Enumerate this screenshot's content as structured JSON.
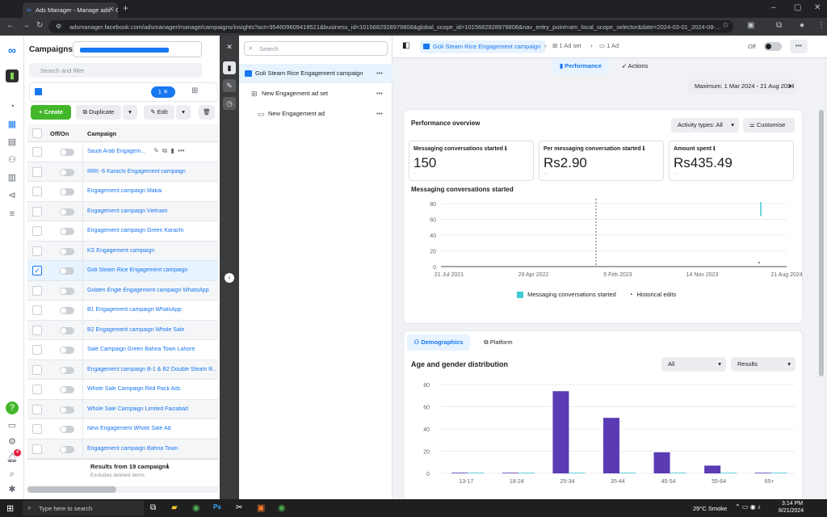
{
  "browser": {
    "tab_title": "Ads Manager - Manage ads - C",
    "url": "adsmanager.facebook.com/adsmanager/manage/campaigns/insights?act=954609609418521&business_id=1015682928979808&global_scope_id=1015682928979808&nav_entry_point=am_local_scope_selector&date=2024-03-01_2024-08-..."
  },
  "campaigns_panel": {
    "title": "Campaigns",
    "search_placeholder": "Search and filter",
    "filter_count": "1",
    "create_label": "Create",
    "duplicate_label": "Duplicate",
    "edit_label": "Edit",
    "col_offon": "Off/On",
    "col_campaign": "Campaign",
    "rows": [
      {
        "name": "Saudi Arab Engagem...",
        "checked": false
      },
      {
        "name": "IRRI -6 Karachi Engagement campaign",
        "checked": false
      },
      {
        "name": "Engagement campaign Makai",
        "checked": false
      },
      {
        "name": "Engagement campaign Vietnam",
        "checked": false
      },
      {
        "name": "Engagement campaign Green Karachi",
        "checked": false
      },
      {
        "name": "KS Engagement campaign",
        "checked": false
      },
      {
        "name": "Goli Steam Rice Engagement campaign",
        "checked": true
      },
      {
        "name": "Golden Engle Engagement campaign WhatsApp",
        "checked": false
      },
      {
        "name": "B1 Engagement campaign WhatsApp",
        "checked": false
      },
      {
        "name": "B2 Engagement campaign Whole Sale",
        "checked": false
      },
      {
        "name": "Sale Campaign Green Bahira Town Lahore",
        "checked": false
      },
      {
        "name": "Engagement campaign B-1 & B2 Double Steam R...",
        "checked": false
      },
      {
        "name": "Whole Sale Campaign Red Pack Ads",
        "checked": false
      },
      {
        "name": "Whole Sale Campaign Limited Faizabad",
        "checked": false
      },
      {
        "name": "New Engagement Whole Sale Ad",
        "checked": false
      },
      {
        "name": "Engagement campaign Bahria Town",
        "checked": false
      }
    ],
    "results_label": "Results from 19 campaigns",
    "results_sub": "Excludes deleted items"
  },
  "tree": {
    "search_placeholder": "Search",
    "campaign": "Goli Steam Rice Engagement campaign",
    "adset": "New Engagement ad set",
    "ad": "New Engagement ad"
  },
  "header": {
    "breadcrumb_campaign": "Goli Steam Rice Engagement campaign",
    "breadcrumb_adset": "1 Ad set",
    "breadcrumb_ad": "1 Ad",
    "toggle_label": "Off",
    "tab_performance": "Performance",
    "tab_actions": "Actions",
    "date_range": "Maximum: 1 Mar 2024 - 21 Aug 2024"
  },
  "overview": {
    "title": "Performance overview",
    "activity_types": "Activity types: All",
    "customise": "Customise",
    "metrics": [
      {
        "label": "Messaging conversations started",
        "value": "150",
        "delta": "--"
      },
      {
        "label": "Per messaging conversation started",
        "value": "Rs2.90",
        "delta": "--"
      },
      {
        "label": "Amount spent",
        "value": "Rs435.49",
        "delta": "--"
      }
    ],
    "chart_title": "Messaging conversations started",
    "legend_series": "Messaging conversations started",
    "legend_hist": "Historical edits"
  },
  "demographics": {
    "tab_demographics": "Demographics",
    "tab_platform": "Platform",
    "title": "Age and gender distribution",
    "filter_all": "All",
    "filter_results": "Results"
  },
  "taskbar": {
    "search": "Type here to search",
    "weather": "29°C  Smoke",
    "time": "3:14 PM",
    "date": "8/21/2024"
  },
  "colors": {
    "brand": "#1877f2",
    "bar": "#5b3bb4",
    "line": "#3fc9d3",
    "create": "#42b72a"
  },
  "chart_data": [
    {
      "type": "line",
      "title": "Messaging conversations started",
      "x_ticks": [
        "21 Jul 2021",
        "29 Apr 2022",
        "5 Feb 2023",
        "14 Nov 2023",
        "21 Aug 2024"
      ],
      "y_ticks": [
        0,
        20,
        40,
        60,
        80
      ],
      "ylim": [
        0,
        80
      ],
      "series": [
        {
          "name": "Messaging conversations started",
          "x": [
            "21 Aug 2024"
          ],
          "values": [
            82
          ]
        }
      ],
      "legend": [
        "Messaging conversations started",
        "Historical edits"
      ]
    },
    {
      "type": "bar",
      "title": "Age and gender distribution",
      "categories": [
        "13-17",
        "18-24",
        "25-34",
        "35-44",
        "45-54",
        "55-64",
        "65+"
      ],
      "y_ticks": [
        0,
        20,
        40,
        60,
        80
      ],
      "ylim": [
        0,
        80
      ],
      "series": [
        {
          "values": [
            0,
            0,
            74,
            50,
            19,
            7,
            0
          ]
        },
        {
          "values": [
            0,
            0,
            0,
            0,
            0,
            0,
            0
          ]
        }
      ]
    }
  ]
}
